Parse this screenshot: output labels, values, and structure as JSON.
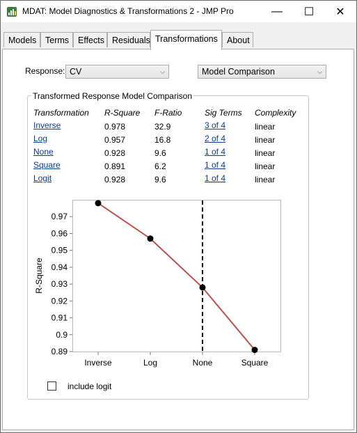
{
  "window": {
    "title": "MDAT: Model Diagnostics & Transformations 2 - JMP Pro",
    "minimize_glyph": "—",
    "maximize_glyph": "☐",
    "close_glyph": "✕"
  },
  "tabs": [
    "Models",
    "Terms",
    "Effects",
    "Residuals",
    "Transformations",
    "About"
  ],
  "active_tab": "Transformations",
  "response": {
    "label": "Response:",
    "value": "CV"
  },
  "view_select": {
    "value": "Model Comparison"
  },
  "group": {
    "title": "Transformed Response Model Comparison"
  },
  "table": {
    "headers": [
      "Transformation",
      "R-Square",
      "F-Ratio",
      "Sig Terms",
      "Complexity"
    ],
    "rows": [
      [
        "Inverse",
        "0.978",
        "32.9",
        "3 of 4",
        "linear"
      ],
      [
        "Log",
        "0.957",
        "16.8",
        "2 of 4",
        "linear"
      ],
      [
        "None",
        "0.928",
        "9.6",
        "1 of 4",
        "linear"
      ],
      [
        "Square",
        "0.891",
        "6.2",
        "1 of 4",
        "linear"
      ],
      [
        "Logit",
        "0.928",
        "9.6",
        "1 of 4",
        "linear"
      ]
    ]
  },
  "chart_data": {
    "type": "line",
    "categories": [
      "Inverse",
      "Log",
      "None",
      "Square"
    ],
    "values": [
      0.978,
      0.957,
      0.928,
      0.891
    ],
    "ylabel": "R-Square",
    "xlabel": "",
    "ylim": [
      0.89,
      0.98
    ],
    "yticks": [
      "0.97",
      "0.96",
      "0.95",
      "0.94",
      "0.93",
      "0.92",
      "0.91",
      "0.9",
      "0.89"
    ],
    "reference_line_category": "None",
    "line_color": "#c0504d",
    "marker_color": "#000000",
    "grid": false
  },
  "checkbox": {
    "label": "include logit",
    "checked": false
  },
  "colors": {
    "link": "#0b3d91",
    "accent": "#c0504d"
  },
  "icons": {
    "app": "jmp-app-icon",
    "dropdown": "chevron-down-icon"
  }
}
